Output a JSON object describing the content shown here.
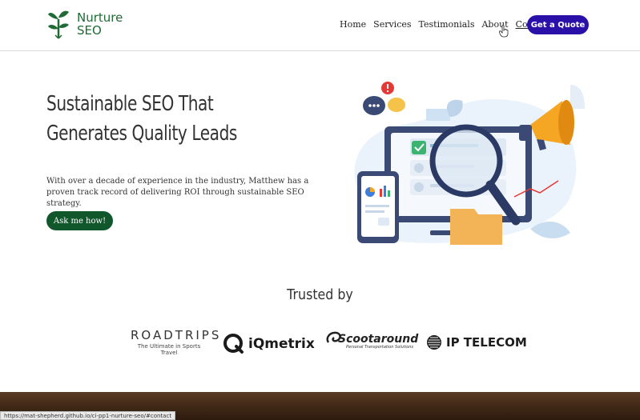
{
  "header": {
    "logo_line1": "Nurture",
    "logo_line2": "SEO",
    "nav": [
      "Home",
      "Services",
      "Testimonials",
      "About",
      "Contact"
    ],
    "cta_label": "Get a Quote"
  },
  "hero": {
    "title_line1": "Sustainable SEO That",
    "title_line2": "Generates Quality Leads",
    "text": "With over a decade of experience in the industry, Matthew has a proven track record of delivering ROI through sustainable SEO strategy.",
    "button_label": "Ask me how!"
  },
  "trusted": {
    "heading": "Trusted by",
    "roadtrips_name": "ROADTRIPS",
    "roadtrips_tagline": "The Ultimate in Sports Travel",
    "iqmetrix_name": "iQmetrix",
    "scootaround_name": "Scootaround",
    "scootaround_tagline": "Personal Transportation Solutions",
    "iptelecom_name": "IP TELECOM"
  },
  "status_bar": {
    "url": "https://mat-shepherd.github.io/ci-pp1-nurture-seo/#contact"
  },
  "colors": {
    "brand_green": "#1f6b35",
    "button_green": "#11572c",
    "cta_purple": "#2a0fa8"
  }
}
